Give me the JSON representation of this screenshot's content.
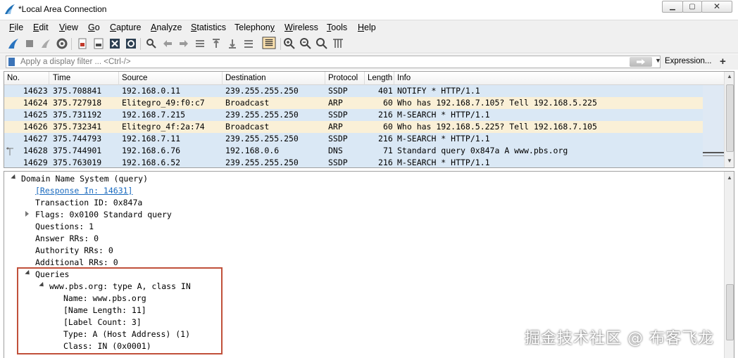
{
  "window": {
    "title": "*Local Area Connection",
    "controls": [
      "minimize",
      "maximize",
      "close"
    ]
  },
  "menu": [
    {
      "key": "F",
      "rest": "ile"
    },
    {
      "key": "E",
      "rest": "dit"
    },
    {
      "key": "V",
      "rest": "iew"
    },
    {
      "key": "G",
      "rest": "o"
    },
    {
      "key": "C",
      "rest": "apture"
    },
    {
      "key": "A",
      "rest": "nalyze"
    },
    {
      "key": "S",
      "rest": "tatistics"
    },
    {
      "key": "",
      "rest": "Telephon",
      "key2": "y"
    },
    {
      "key": "W",
      "rest": "ireless"
    },
    {
      "key": "T",
      "rest": "ools"
    },
    {
      "key": "H",
      "rest": "elp"
    }
  ],
  "filter": {
    "placeholder": "Apply a display filter ... <Ctrl-/>",
    "expression_label": "Expression...",
    "plus": "+"
  },
  "packet_list": {
    "columns": [
      "No.",
      "Time",
      "Source",
      "Destination",
      "Protocol",
      "Length",
      "Info"
    ],
    "rows": [
      {
        "no": "14623",
        "time": "375.708841",
        "src": "192.168.0.11",
        "dst": "239.255.255.250",
        "proto": "SSDP",
        "len": "401",
        "info": "NOTIFY * HTTP/1.1",
        "kind": "ssdp"
      },
      {
        "no": "14624",
        "time": "375.727918",
        "src": "Elitegro_49:f0:c7",
        "dst": "Broadcast",
        "proto": "ARP",
        "len": "60",
        "info": "Who has 192.168.7.105? Tell 192.168.5.225",
        "kind": "arp"
      },
      {
        "no": "14625",
        "time": "375.731192",
        "src": "192.168.7.215",
        "dst": "239.255.255.250",
        "proto": "SSDP",
        "len": "216",
        "info": "M-SEARCH * HTTP/1.1",
        "kind": "ssdp"
      },
      {
        "no": "14626",
        "time": "375.732341",
        "src": "Elitegro_4f:2a:74",
        "dst": "Broadcast",
        "proto": "ARP",
        "len": "60",
        "info": "Who has 192.168.5.225? Tell 192.168.7.105",
        "kind": "arp"
      },
      {
        "no": "14627",
        "time": "375.744793",
        "src": "192.168.7.11",
        "dst": "239.255.255.250",
        "proto": "SSDP",
        "len": "216",
        "info": "M-SEARCH * HTTP/1.1",
        "kind": "ssdp"
      },
      {
        "no": "14628",
        "time": "375.744901",
        "src": "192.168.6.76",
        "dst": "192.168.0.6",
        "proto": "DNS",
        "len": "71",
        "info": "Standard query 0x847a A www.pbs.org",
        "kind": "dns"
      },
      {
        "no": "14629",
        "time": "375.763019",
        "src": "192.168.6.52",
        "dst": "239.255.255.250",
        "proto": "SSDP",
        "len": "216",
        "info": "M-SEARCH * HTTP/1.1",
        "kind": "ssdp"
      }
    ],
    "related_marker": "14628"
  },
  "details": {
    "root": "Domain Name System (query)",
    "response_in": "[Response In: 14631]",
    "transaction_id": "Transaction ID: 0x847a",
    "flags": "Flags: 0x0100 Standard query",
    "questions": "Questions: 1",
    "answer_rrs": "Answer RRs: 0",
    "authority_rrs": "Authority RRs: 0",
    "additional_rrs": "Additional RRs: 0",
    "queries": "Queries",
    "query_entry": "www.pbs.org: type A, class IN",
    "name": "Name: www.pbs.org",
    "name_length": "[Name Length: 11]",
    "label_count": "[Label Count: 3]",
    "type": "Type: A (Host Address) (1)",
    "class": "Class: IN (0x0001)"
  },
  "watermark": "掘金技术社区 @ 布客飞龙",
  "colors": {
    "ssdp_row": "#dae8f5",
    "arp_row": "#faf0d7",
    "highlight": "#c0503a",
    "link": "#1b6bbf"
  }
}
